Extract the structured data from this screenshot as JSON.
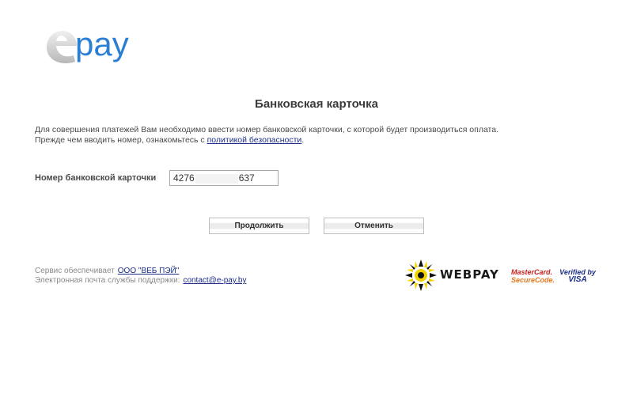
{
  "logo": {
    "text": "epay",
    "accent_color": "#2a7fd4"
  },
  "title": "Банковская карточка",
  "intro": {
    "line1": "Для совершения платежей Вам необходимо ввести номер банковской карточки, с которой будет производиться оплата.",
    "line2_prefix": "Прежде чем вводить номер, ознакомьтесь с ",
    "link_text": "политикой безопасности",
    "line2_suffix": "."
  },
  "card_field": {
    "label": "Номер банковской карточки",
    "value_start": "4276",
    "value_end": "637"
  },
  "buttons": {
    "continue": "Продолжить",
    "cancel": "Отменить"
  },
  "footer": {
    "service_label": "Сервис обеспечивает",
    "service_link": "ООО \"ВЕБ ПЭЙ\"",
    "email_label": "Электронная почта службы поддержки:",
    "email_link": "contact@e-pay.by"
  },
  "partners": {
    "webpay": "WEBPAY",
    "mastercard_line1": "MasterCard.",
    "mastercard_line2": "SecureCode.",
    "visa_line1": "Verified by",
    "visa_line2": "VISA"
  }
}
